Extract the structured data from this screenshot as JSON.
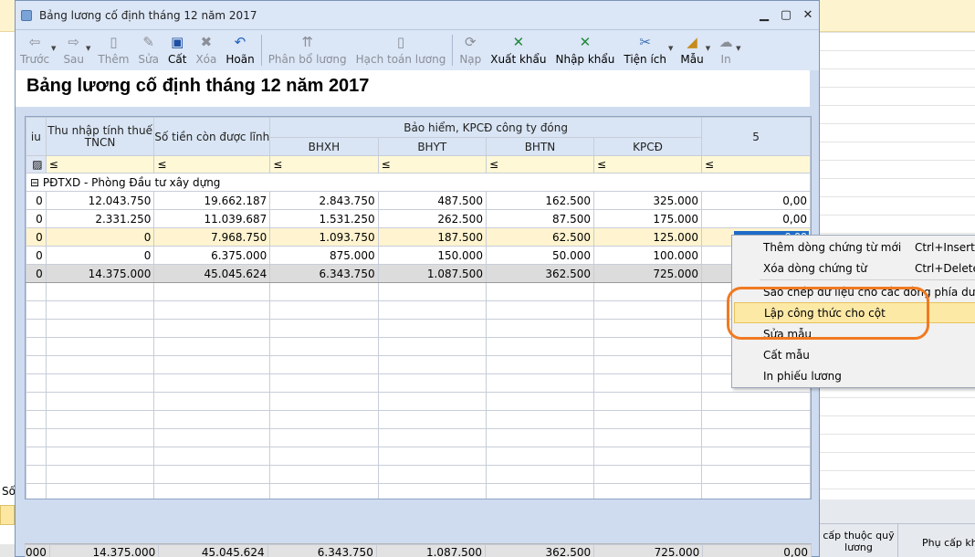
{
  "window": {
    "title": "Bảng lương cố định tháng 12 năm 2017"
  },
  "toolbar": {
    "buttons": [
      {
        "label": "Trước",
        "icon": "arrow-left-icon",
        "disabled": true
      },
      {
        "label": "Sau",
        "icon": "arrow-right-icon",
        "disabled": true
      },
      {
        "label": "Thêm",
        "icon": "add-doc-icon",
        "disabled": true
      },
      {
        "label": "Sửa",
        "icon": "edit-doc-icon",
        "disabled": true
      },
      {
        "label": "Cất",
        "icon": "save-icon",
        "disabled": false
      },
      {
        "label": "Xóa",
        "icon": "delete-icon",
        "disabled": true
      },
      {
        "label": "Hoãn",
        "icon": "undo-icon",
        "disabled": false
      },
      {
        "label": "Phân bổ lương",
        "icon": "distribute-icon",
        "disabled": true
      },
      {
        "label": "Hạch toán lương",
        "icon": "accounting-icon",
        "disabled": true
      },
      {
        "label": "Nạp",
        "icon": "reload-icon",
        "disabled": true
      },
      {
        "label": "Xuất khẩu",
        "icon": "excel-export-icon",
        "disabled": false
      },
      {
        "label": "Nhập khẩu",
        "icon": "excel-import-icon",
        "disabled": false
      },
      {
        "label": "Tiện ích",
        "icon": "tools-icon",
        "disabled": false
      },
      {
        "label": "Mẫu",
        "icon": "template-icon",
        "disabled": false
      },
      {
        "label": "In",
        "icon": "print-icon",
        "disabled": true
      }
    ]
  },
  "page": {
    "heading": "Bảng lương cố định tháng 12 năm 2017"
  },
  "grid": {
    "headers": {
      "cut": "iu",
      "thu_nhap": "Thu nhập tính thuế TNCN",
      "so_tien": "Số tiền còn được lĩnh",
      "group": "Bảo hiểm, KPCĐ công ty đóng",
      "bhxh": "BHXH",
      "bhyt": "BHYT",
      "bhtn": "BHTN",
      "kpcd": "KPCĐ",
      "col5": "5"
    },
    "filter_symbol": "≤",
    "group_toggle": "⊟",
    "group_label": "PĐTXD - Phòng Đầu tư xây dựng",
    "rows": [
      {
        "lead": "0",
        "thu_nhap": "12.043.750",
        "so_tien": "19.662.187",
        "bhxh": "2.843.750",
        "bhyt": "487.500",
        "bhtn": "162.500",
        "kpcd": "325.000",
        "col5": "0,00"
      },
      {
        "lead": "0",
        "thu_nhap": "2.331.250",
        "so_tien": "11.039.687",
        "bhxh": "1.531.250",
        "bhyt": "262.500",
        "bhtn": "87.500",
        "kpcd": "175.000",
        "col5": "0,00"
      },
      {
        "lead": "0",
        "thu_nhap": "0",
        "so_tien": "7.968.750",
        "bhxh": "1.093.750",
        "bhyt": "187.500",
        "bhtn": "62.500",
        "kpcd": "125.000",
        "col5": "0,00"
      },
      {
        "lead": "0",
        "thu_nhap": "0",
        "so_tien": "6.375.000",
        "bhxh": "875.000",
        "bhyt": "150.000",
        "bhtn": "50.000",
        "kpcd": "100.000",
        "col5": ""
      }
    ],
    "subtotal": {
      "lead": "0",
      "thu_nhap": "14.375.000",
      "so_tien": "45.045.624",
      "bhxh": "6.343.750",
      "bhyt": "1.087.500",
      "bhtn": "362.500",
      "kpcd": "725.000",
      "col5": ""
    },
    "grand_total": {
      "lead": "000",
      "thu_nhap": "14.375.000",
      "so_tien": "45.045.624",
      "bhxh": "6.343.750",
      "bhyt": "1.087.500",
      "bhtn": "362.500",
      "kpcd": "725.000",
      "col5": "0,00"
    }
  },
  "context_menu": {
    "items": [
      {
        "label": "Thêm dòng chứng từ mới",
        "shortcut": "Ctrl+Insert"
      },
      {
        "label": "Xóa dòng chứng từ",
        "shortcut": "Ctrl+Delete"
      },
      {
        "label": "Sao chép dữ liệu cho các dòng phía dưới",
        "shortcut": ""
      },
      {
        "label": "Lập công thức cho cột",
        "shortcut": ""
      },
      {
        "label": "Sửa mẫu",
        "shortcut": ""
      },
      {
        "label": "Cất mẫu",
        "shortcut": ""
      },
      {
        "label": "In phiếu lương",
        "shortcut": ""
      }
    ]
  },
  "background": {
    "left_label": "Số",
    "right_header_1": "cấp thuộc quỹ lương",
    "right_header_2": "Phụ cấp khá"
  },
  "colors": {
    "highlight": "#fde9a6",
    "annotation": "#f07a22",
    "selection": "#1f6cc8"
  }
}
